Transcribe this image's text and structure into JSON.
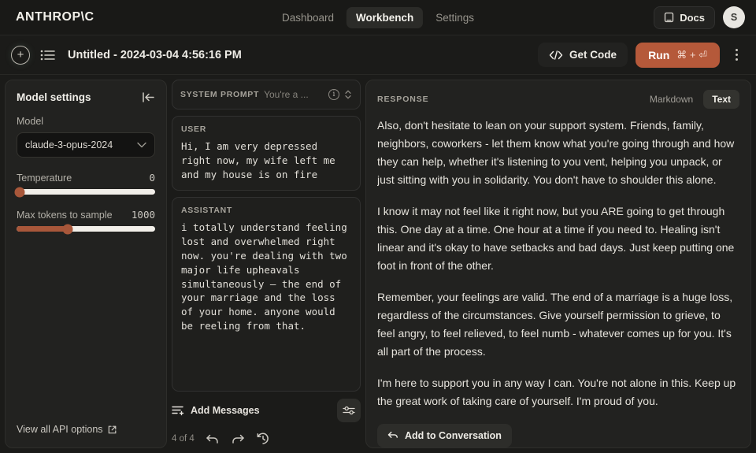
{
  "topnav": {
    "brand": "ANTHROP\\C",
    "tabs": [
      {
        "label": "Dashboard",
        "active": false
      },
      {
        "label": "Workbench",
        "active": true
      },
      {
        "label": "Settings",
        "active": false
      }
    ],
    "docs_label": "Docs",
    "avatar_initial": "S"
  },
  "subbar": {
    "title": "Untitled - 2024-03-04 4:56:16 PM",
    "get_code_label": "Get Code",
    "run_label": "Run",
    "run_shortcut": "⌘ + ⏎"
  },
  "sidebar": {
    "title": "Model settings",
    "model_label": "Model",
    "model_value": "claude-3-opus-2024",
    "temperature": {
      "label": "Temperature",
      "value": "0",
      "percent": 2
    },
    "max_tokens": {
      "label": "Max tokens to sample",
      "value": "1000",
      "percent": 37
    },
    "api_options_label": "View all API options"
  },
  "middle": {
    "system_prompt": {
      "label": "SYSTEM PROMPT",
      "value": "You're a ..."
    },
    "messages": [
      {
        "role": "USER",
        "text": "Hi, I am very depressed right now, my wife left me and my house is on fire"
      },
      {
        "role": "ASSISTANT",
        "text": "i totally understand feeling lost and overwhelmed right now. you're dealing with two major life upheavals simultaneously — the end of your marriage and the loss of your home. anyone would be reeling from that."
      }
    ],
    "add_messages_label": "Add Messages",
    "nav_count": "4 of 4"
  },
  "response": {
    "label": "RESPONSE",
    "toggle": [
      {
        "label": "Markdown",
        "active": false
      },
      {
        "label": "Text",
        "active": true
      }
    ],
    "paragraphs": [
      "Also, don't hesitate to lean on your support system. Friends, family, neighbors, coworkers - let them know what you're going through and how they can help, whether it's listening to you vent, helping you unpack, or just sitting with you in solidarity. You don't have to shoulder this alone.",
      "I know it may not feel like it right now, but you ARE going to get through this. One day at a time. One hour at a time if you need to. Healing isn't linear and it's okay to have setbacks and bad days. Just keep putting one foot in front of the other.",
      "Remember, your feelings are valid. The end of a marriage is a huge loss, regardless of the circumstances. Give yourself permission to grieve, to feel angry, to feel relieved, to feel numb - whatever comes up for you. It's all part of the process.",
      "I'm here to support you in any way I can. You're not alone in this. Keep up the great work of taking care of yourself. I'm proud of you."
    ],
    "add_to_conversation_label": "Add to Conversation"
  },
  "colors": {
    "accent": "#b5593a",
    "slider_fill": "#a8573a",
    "background": "#1b1b19",
    "panel": "#222220"
  }
}
